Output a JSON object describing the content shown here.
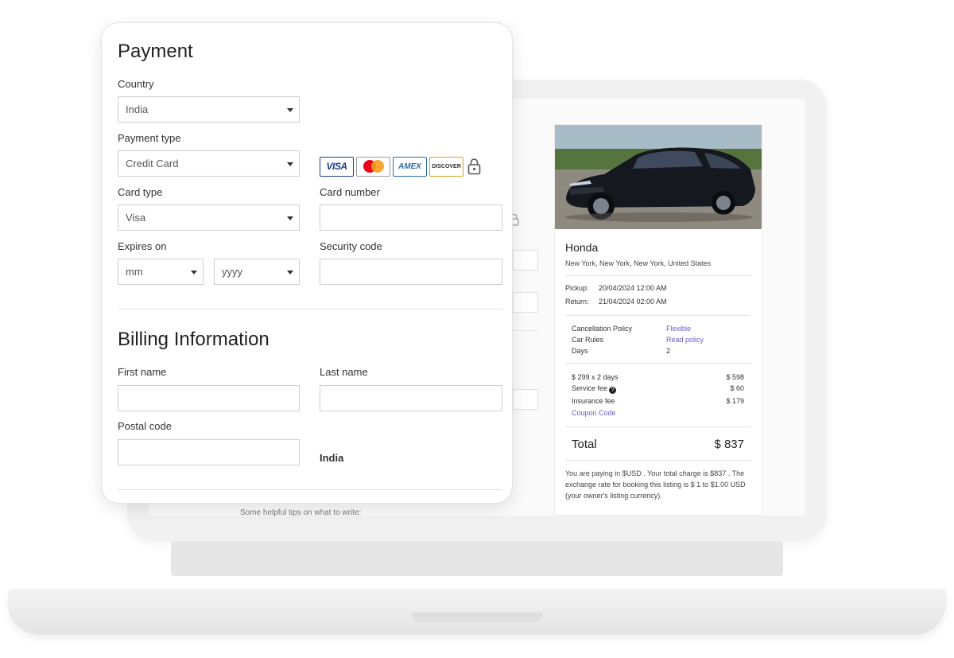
{
  "payment": {
    "title": "Payment",
    "country_label": "Country",
    "country_value": "India",
    "payment_type_label": "Payment type",
    "payment_type_value": "Credit Card",
    "accepted_cards": [
      "VISA",
      "AMEX",
      "DISCOVER"
    ],
    "card_type_label": "Card type",
    "card_type_value": "Visa",
    "card_number_label": "Card number",
    "card_number_value": "",
    "expires_label": "Expires on",
    "expires_month_value": "mm",
    "expires_year_value": "yyyy",
    "security_code_label": "Security code",
    "security_code_value": ""
  },
  "billing": {
    "title": "Billing Information",
    "first_name_label": "First name",
    "first_name_value": "",
    "last_name_label": "Last name",
    "last_name_value": "",
    "postal_code_label": "Postal code",
    "postal_code_value": "",
    "country_value": "India"
  },
  "background": {
    "tips_text": "Some helpful tips on what to write:"
  },
  "summary": {
    "car_name": "Honda",
    "location": "New York, New York, New York, United States",
    "pickup_label": "Pickup:",
    "pickup_value": "20/04/2024 12:00 AM",
    "return_label": "Return:",
    "return_value": "21/04/2024 02:00 AM",
    "policies": [
      {
        "label": "Cancellation Policy",
        "value": "Flexible",
        "is_link": true
      },
      {
        "label": "Car Rules",
        "value": "Read policy",
        "is_link": true
      },
      {
        "label": "Days",
        "value": "2",
        "is_link": false
      }
    ],
    "fees": [
      {
        "label": "$ 299 x 2 days",
        "value": "$ 598"
      },
      {
        "label": "Service fee",
        "value": "$ 60"
      },
      {
        "label": "Insurance fee",
        "value": "$ 179"
      }
    ],
    "coupon_label": "Coupon Code",
    "total_label": "Total",
    "total_value": "$ 837",
    "payment_note": "You are paying in $USD . Your total charge is $837 . The exchange rate for booking this listing is $ 1 to $1.00 USD (your owner's listing currency)."
  },
  "colors": {
    "link": "#6a5acd",
    "visa": "#1a3e8c",
    "mastercard_red": "#eb001b",
    "mastercard_orange": "#f79e1b",
    "amex": "#2a6db0",
    "discover": "#d9a21b"
  }
}
